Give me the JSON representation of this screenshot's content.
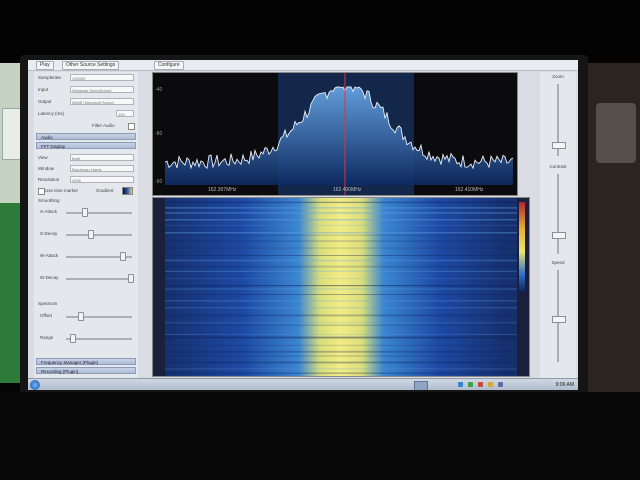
{
  "toolbar": {
    "buttons": [
      "Play",
      "Other Source Settings",
      "Configure"
    ]
  },
  "source": {
    "rows": [
      {
        "label": "Samplerate",
        "value": "192000"
      },
      {
        "label": "Input",
        "value": "Windows DirectSound"
      },
      {
        "label": "Output",
        "value": "[MME] Microsoft Sound"
      },
      {
        "label": "Latency (ms)",
        "value": "100"
      }
    ],
    "filter_audio_label": "Filter Audio"
  },
  "sections": {
    "audio": "Audio",
    "fft_display": "FFT Display",
    "frequency_manager": "Frequency Manager (Plugin)",
    "recording": "Recording (Plugin)"
  },
  "fft": {
    "rows": [
      {
        "label": "View",
        "value": "Both"
      },
      {
        "label": "Window",
        "value": "Blackman-Harris"
      },
      {
        "label": "Resolution",
        "value": "4096"
      }
    ],
    "time_markers_label": "Use time marker",
    "gradient_label": "Gradient",
    "smoothing_label": "Smoothing",
    "sliders": [
      "S-Attack",
      "S-Decay",
      "W-Attack",
      "W-Decay"
    ],
    "spectrum_label": "Spectrum",
    "sliders2": [
      "Offset",
      "Range"
    ]
  },
  "spectrum": {
    "db_labels": [
      "-40",
      "-80",
      "-90"
    ],
    "freq_labels": [
      "162.397MHz",
      "162.400MHz",
      "162.410MHz"
    ],
    "marker_color": "#e0303a",
    "trace_color": "#e9eef6",
    "fill_color": "#2f7fd6"
  },
  "right_panel": {
    "labels": [
      "Zoom",
      "Contrast",
      "Speed"
    ]
  },
  "taskbar": {
    "clock": "9:06 AM"
  }
}
